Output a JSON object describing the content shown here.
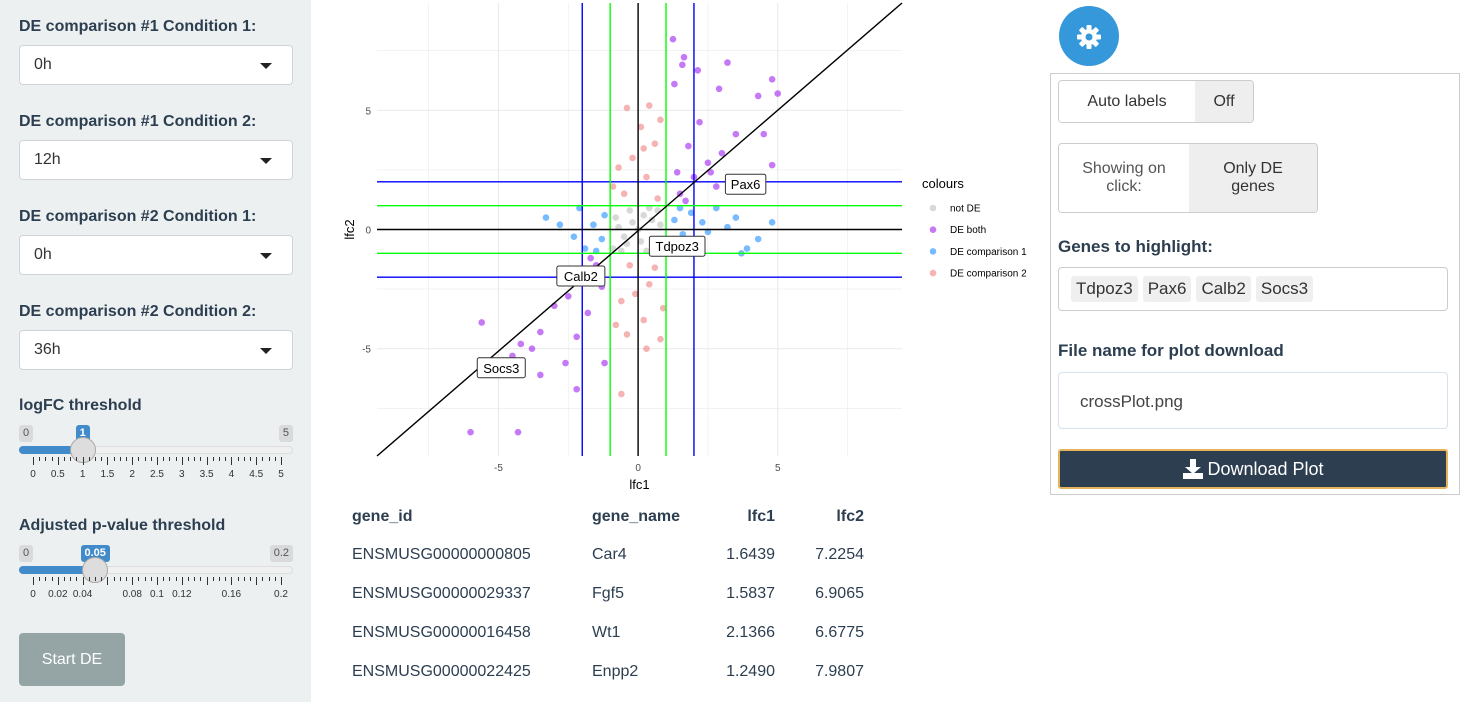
{
  "sidebar": {
    "de1_cond1": {
      "label": "DE comparison #1 Condition 1:",
      "value": "0h"
    },
    "de1_cond2": {
      "label": "DE comparison #1 Condition 2:",
      "value": "12h"
    },
    "de2_cond1": {
      "label": "DE comparison #2 Condition 1:",
      "value": "0h"
    },
    "de2_cond2": {
      "label": "DE comparison #2 Condition 2:",
      "value": "36h"
    },
    "logfc": {
      "label": "logFC threshold",
      "min": "0",
      "max": "5",
      "value": "1",
      "value_num": 1,
      "range": [
        0,
        5
      ],
      "tick_labels": [
        "0",
        "0.5",
        "1",
        "1.5",
        "2",
        "2.5",
        "3",
        "3.5",
        "4",
        "4.5",
        "5"
      ]
    },
    "pval": {
      "label": "Adjusted p-value threshold",
      "min": "0",
      "max": "0.2",
      "value": "0.05",
      "value_num": 0.05,
      "range": [
        0,
        0.2
      ],
      "tick_labels": [
        "0",
        "0.02",
        "0.04",
        "0.08",
        "0.1",
        "0.12",
        "0.16",
        "0.2"
      ]
    },
    "start_label": "Start DE"
  },
  "chart_data": {
    "type": "scatter",
    "xlabel": "lfc1",
    "ylabel": "lfc2",
    "xlim": [
      -9.35,
      9.45
    ],
    "ylim": [
      -9.5,
      9.5
    ],
    "x_ticks": [
      "-5",
      "0",
      "5"
    ],
    "y_ticks": [
      "-5",
      "0",
      "5"
    ],
    "grid": true,
    "legend_title": "colours",
    "legend_placement": "right",
    "reference_lines": {
      "threshold_inner": 1,
      "threshold_outer": 2,
      "inner_color": "#00ff00",
      "outer_color": "#0000ff",
      "zero_color": "#000000",
      "diagonal": "y = x"
    },
    "series": [
      {
        "name": "not DE",
        "color": "#bebebe",
        "points": [
          [
            -0.8,
            0.5
          ],
          [
            -0.5,
            -0.3
          ],
          [
            0.2,
            0.6
          ],
          [
            0.6,
            -0.7
          ],
          [
            -0.3,
            0.8
          ],
          [
            0.8,
            0.2
          ],
          [
            0,
            0
          ],
          [
            -0.9,
            -0.8
          ],
          [
            0.4,
            0.9
          ],
          [
            -0.6,
            -0.9
          ],
          [
            0.9,
            -0.4
          ],
          [
            0.1,
            -0.5
          ],
          [
            -0.2,
            0.3
          ],
          [
            0.5,
            0.4
          ],
          [
            -0.7,
            0.1
          ],
          [
            0.3,
            -0.9
          ],
          [
            0.7,
            0.8
          ],
          [
            -0.4,
            -0.6
          ]
        ]
      },
      {
        "name": "DE both",
        "color": "#a020f0",
        "points": [
          [
            1.5,
            1.5
          ],
          [
            2.0,
            2.2
          ],
          [
            2.5,
            2.8
          ],
          [
            1.8,
            3.5
          ],
          [
            3.0,
            3.2
          ],
          [
            3.5,
            4.0
          ],
          [
            2.2,
            4.5
          ],
          [
            1.3,
            6.1
          ],
          [
            1.6439,
            7.2254
          ],
          [
            1.5837,
            6.9065
          ],
          [
            2.1366,
            6.6775
          ],
          [
            1.249,
            7.9807
          ],
          [
            4.8,
            6.3
          ],
          [
            3.2,
            7.0
          ],
          [
            4.3,
            5.6
          ],
          [
            4.5,
            4.0
          ],
          [
            5.0,
            5.7
          ],
          [
            4.8,
            2.7
          ],
          [
            1.4,
            2.4
          ],
          [
            2.8,
            1.8
          ],
          [
            3.3,
            2.2
          ],
          [
            1.7,
            1.2
          ],
          [
            -1.5,
            -1.5
          ],
          [
            -2.0,
            -2.2
          ],
          [
            -2.5,
            -2.8
          ],
          [
            -1.8,
            -3.5
          ],
          [
            -3.0,
            -3.2
          ],
          [
            -3.5,
            -4.3
          ],
          [
            -2.2,
            -4.5
          ],
          [
            -4.2,
            -4.8
          ],
          [
            -5.6,
            -3.9
          ],
          [
            -3.5,
            -6.1
          ],
          [
            -2.2,
            -6.7
          ],
          [
            -6.0,
            -8.5
          ],
          [
            -4.3,
            -8.5
          ],
          [
            -1.3,
            -2.4
          ],
          [
            -2.8,
            -1.8
          ],
          [
            -1.2,
            -5.6
          ],
          [
            -1.7,
            -1.2
          ],
          [
            -3.8,
            -5.0
          ],
          [
            -2.6,
            -5.6
          ],
          [
            -4.5,
            -5.3
          ],
          [
            2.9,
            5.9
          ],
          [
            2.6,
            2.4
          ]
        ]
      },
      {
        "name": "DE comparison 1",
        "color": "#1e90ff",
        "points": [
          [
            1.3,
            0.4
          ],
          [
            1.6,
            -0.2
          ],
          [
            1.9,
            0.7
          ],
          [
            2.3,
            0.3
          ],
          [
            2.8,
            0.9
          ],
          [
            3.5,
            0.5
          ],
          [
            4.3,
            -0.4
          ],
          [
            4.8,
            0.3
          ],
          [
            3.9,
            -0.8
          ],
          [
            2.5,
            -0.1
          ],
          [
            1.2,
            -0.6
          ],
          [
            1.5,
            0.9
          ],
          [
            -1.3,
            -0.4
          ],
          [
            -1.6,
            0.2
          ],
          [
            -1.9,
            -0.8
          ],
          [
            -2.3,
            -0.3
          ],
          [
            -2.8,
            0.2
          ],
          [
            -3.3,
            0.5
          ],
          [
            -2.1,
            0.9
          ],
          [
            -1.2,
            0.6
          ],
          [
            -1.5,
            -0.9
          ],
          [
            3.2,
            0.1
          ],
          [
            2.0,
            -0.5
          ],
          [
            3.7,
            -1.0
          ]
        ]
      },
      {
        "name": "DE comparison 2",
        "color": "#f08080",
        "points": [
          [
            -0.5,
            1.5
          ],
          [
            0.3,
            2.2
          ],
          [
            -0.2,
            3.0
          ],
          [
            0.6,
            3.6
          ],
          [
            -0.7,
            2.6
          ],
          [
            0.1,
            4.3
          ],
          [
            0.4,
            5.2
          ],
          [
            -0.4,
            5.1
          ],
          [
            0.8,
            4.6
          ],
          [
            -0.9,
            1.8
          ],
          [
            0.7,
            1.3
          ],
          [
            0.2,
            3.4
          ],
          [
            -0.3,
            -1.5
          ],
          [
            0.4,
            -2.3
          ],
          [
            -0.6,
            -3.0
          ],
          [
            0.2,
            -3.8
          ],
          [
            -0.8,
            -4.0
          ],
          [
            0.9,
            -3.3
          ],
          [
            -0.4,
            -4.4
          ],
          [
            0.8,
            -4.6
          ],
          [
            -0.1,
            -2.7
          ],
          [
            0.6,
            -1.6
          ],
          [
            -0.6,
            -6.9
          ],
          [
            0.3,
            -5.0
          ]
        ]
      }
    ],
    "annotations": [
      {
        "text": "Pax6",
        "x": 3.85,
        "y": 1.9
      },
      {
        "text": "Tdpoz3",
        "x": 1.4,
        "y": -0.7
      },
      {
        "text": "Calb2",
        "x": -2.05,
        "y": -1.95
      },
      {
        "text": "Socs3",
        "x": -4.9,
        "y": -5.8
      }
    ]
  },
  "table": {
    "headers": [
      "gene_id",
      "gene_name",
      "lfc1",
      "lfc2"
    ],
    "rows": [
      [
        "ENSMUSG00000000805",
        "Car4",
        "1.6439",
        "7.2254"
      ],
      [
        "ENSMUSG00000029337",
        "Fgf5",
        "1.5837",
        "6.9065"
      ],
      [
        "ENSMUSG00000016458",
        "Wt1",
        "2.1366",
        "6.6775"
      ],
      [
        "ENSMUSG00000022425",
        "Enpp2",
        "1.2490",
        "7.9807"
      ]
    ]
  },
  "settings": {
    "gear_icon": "gear-icon",
    "auto_labels": {
      "label": "Auto labels",
      "value": "Off"
    },
    "showing": {
      "label": "Showing on click:",
      "value": "Only DE genes"
    },
    "genes_label": "Genes to highlight:",
    "genes": [
      "Tdpoz3",
      "Pax6",
      "Calb2",
      "Socs3"
    ],
    "filename_label": "File name for plot download",
    "filename_value": "crossPlot.png",
    "download_label": "Download Plot",
    "accent": "#3498db"
  }
}
